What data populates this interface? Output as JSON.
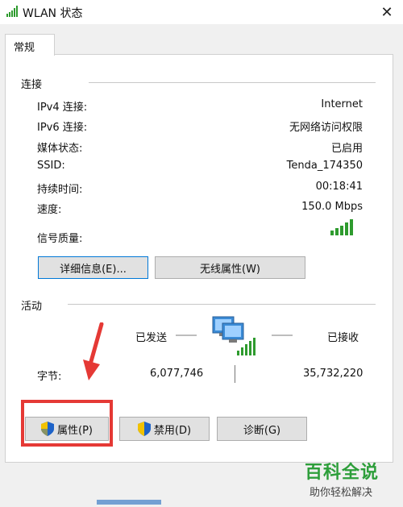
{
  "window": {
    "title": "WLAN 状态",
    "close_glyph": "✕"
  },
  "tabs": [
    {
      "label": "常规"
    }
  ],
  "connection": {
    "section_label": "连接",
    "rows": [
      {
        "label": "IPv4 连接:",
        "value": "Internet"
      },
      {
        "label": "IPv6 连接:",
        "value": "无网络访问权限"
      },
      {
        "label": "媒体状态:",
        "value": "已启用"
      },
      {
        "label": "SSID:",
        "value": "Tenda_174350"
      },
      {
        "label": "持续时间:",
        "value": "00:18:41"
      },
      {
        "label": "速度:",
        "value": "150.0 Mbps"
      }
    ],
    "signal_label": "信号质量:",
    "signal_icon": "signal-bars-icon",
    "details_button": "详细信息(E)...",
    "wireless_button": "无线属性(W)"
  },
  "activity": {
    "section_label": "活动",
    "sent_label": "已发送",
    "received_label": "已接收",
    "bytes_label": "字节:",
    "bytes_sent": "6,077,746",
    "bytes_received": "35,732,220"
  },
  "buttons": {
    "properties": "属性(P)",
    "disable": "禁用(D)",
    "diagnose": "诊断(G)"
  },
  "annotation": {
    "highlight_color": "#e53935"
  },
  "watermark": {
    "main": "百科全说",
    "sub": "助你轻松解决"
  },
  "colors": {
    "accent": "#0078d7",
    "signal_green": "#2e9b2e",
    "shield_blue": "#1e63c8",
    "shield_yellow": "#f2c200"
  }
}
